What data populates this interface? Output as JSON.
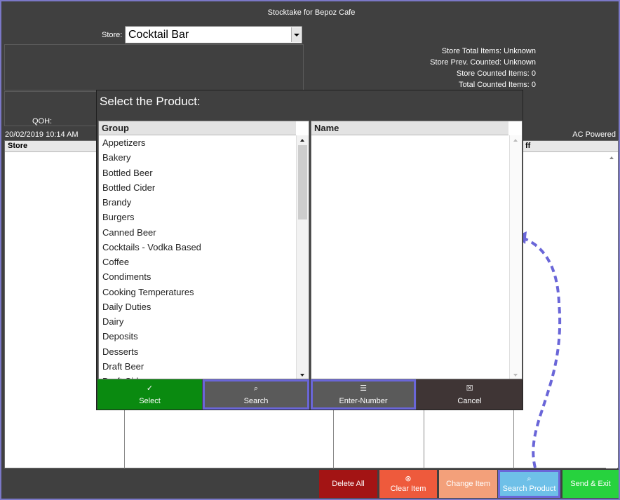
{
  "window": {
    "title": "Stocktake for Bepoz Cafe"
  },
  "store": {
    "label": "Store:",
    "value": "Cocktail Bar"
  },
  "info": {
    "total_items": "Store Total Items: Unknown",
    "prev_counted": "Store Prev. Counted: Unknown",
    "counted_items": "Store Counted Items: 0",
    "total_counted": "Total Counted Items: 0"
  },
  "qoh_label": "QOH:",
  "status": {
    "datetime": "20/02/2019 10:14 AM",
    "power": "AC Powered"
  },
  "grid": {
    "columns": [
      "Store",
      "ff"
    ]
  },
  "dialog": {
    "title": "Select the Product:",
    "group_header": "Group",
    "name_header": "Name",
    "groups": [
      "Appetizers",
      "Bakery",
      "Bottled Beer",
      "Bottled Cider",
      "Brandy",
      "Burgers",
      "Canned Beer",
      "Cocktails - Vodka Based",
      "Coffee",
      "Condiments",
      "Cooking Temperatures",
      "Daily Duties",
      "Dairy",
      "Deposits",
      "Desserts",
      "Draft Beer",
      "Draft Cider"
    ],
    "buttons": {
      "select": "Select",
      "search": "Search",
      "enter_number": "Enter-Number",
      "cancel": "Cancel"
    }
  },
  "bottom_buttons": {
    "delete_all": "Delete All",
    "clear_item": "Clear Item",
    "change_item": "Change Item",
    "search_product": "Search Product",
    "send_exit": "Send & Exit"
  },
  "icons": {
    "select": "check-icon",
    "search": "search-icon",
    "enter_number": "list-icon",
    "cancel": "trash-icon",
    "clear_item": "close-circle-icon",
    "search_product": "search-icon"
  },
  "colors": {
    "background": "#404040",
    "select_green": "#0a8a10",
    "search_grey": "#5a5a5a",
    "cancel_brown": "#3f3535",
    "delete_red": "#a31414",
    "clear_orange": "#ee5a3c",
    "change_peach": "#f3a07a",
    "search_blue": "#6ec0e8",
    "send_green": "#27d23e",
    "highlight": "#6a66d8"
  }
}
